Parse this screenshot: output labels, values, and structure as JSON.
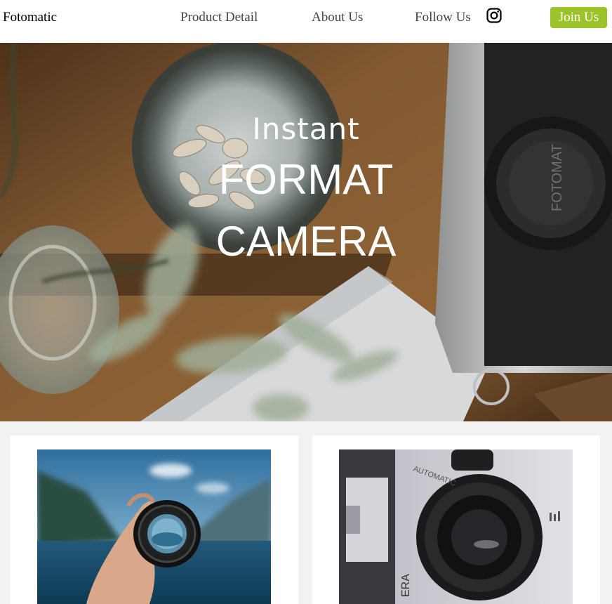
{
  "header": {
    "logo": "Fotomatic",
    "nav": {
      "product_detail": "Product Detail",
      "about_us": "About Us",
      "follow_us": "Follow Us"
    },
    "instagram_icon": "instagram-icon",
    "join_label": "Join Us",
    "join_color": "#9cc32a"
  },
  "hero": {
    "line1": "Instant",
    "line2": "FORMAT",
    "line3": "CAMERA",
    "camera_cap_text": "FOTOMAT"
  },
  "cards": {
    "card1_image": "lens-held-over-lake-photo",
    "card2_image": "camera-body-lens-photo",
    "card2_lens_text": "AUTOMATIC",
    "card2_side_text": "ERA"
  }
}
